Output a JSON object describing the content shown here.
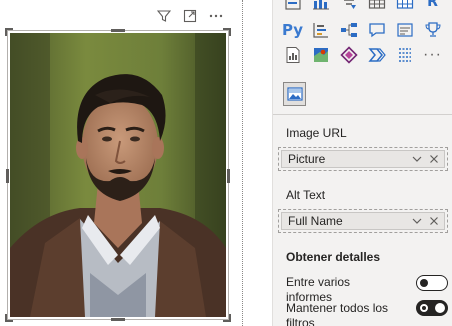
{
  "canvas": {
    "visual_header_icons": [
      "filter-icon",
      "focus-mode-icon",
      "more-options-icon"
    ],
    "image_visual": {
      "content": "portrait-photo"
    }
  },
  "visualizations": {
    "rows": [
      [
        "table-chart-icon",
        "line-clustered-column-icon",
        "funnel-icon",
        "table-icon",
        "matrix-icon",
        "r-visual-icon"
      ],
      [
        "python-visual-icon",
        "key-influencers-icon",
        "decomposition-tree-icon",
        "qa-icon",
        "smart-narrative-icon",
        "trophy-icon"
      ],
      [
        "paginated-report-icon",
        "azure-map-icon",
        "power-apps-icon",
        "power-automate-icon",
        "dashed-doc-icon",
        "more-visuals-icon"
      ]
    ],
    "text_glyphs": {
      "py": "Py",
      "r": "R",
      "more": "···"
    },
    "selected": "image-visual-icon"
  },
  "fields": {
    "image_url_label": "Image URL",
    "image_url_value": "Picture",
    "alt_text_label": "Alt Text",
    "alt_text_value": "Full Name"
  },
  "drillthrough": {
    "title": "Obtener detalles",
    "cross_report_label": "Entre varios informes",
    "cross_report_on": false,
    "keep_filters_label": "Mantener todos los filtros",
    "keep_filters_on": true
  },
  "colors": {
    "accent_blue": "#2b6cc4",
    "pane_bg": "#f3f2f1",
    "toggle_dark": "#252423"
  }
}
